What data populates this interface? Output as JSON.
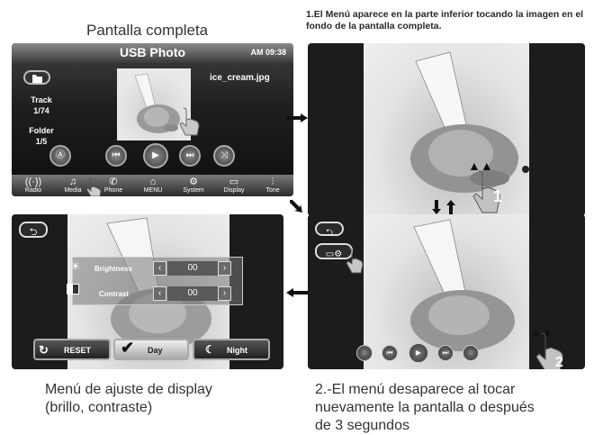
{
  "captions": {
    "top_left": "Pantalla completa",
    "top_right": "1.El Menú aparece en la parte inferior tocando la imagen en el fondo de la pantalla completa.",
    "bottom_left_1": "Menú de ajuste de display",
    "bottom_left_2": "(brillo, contraste)",
    "bottom_right_1": "2.-El menú desaparece al tocar",
    "bottom_right_2": "nuevamente la pantalla o después",
    "bottom_right_3": "de 3 segundos"
  },
  "main_screen": {
    "title": "USB Photo",
    "clock": "AM 09:38",
    "filename": "ice_cream.jpg",
    "track_label": "Track",
    "track_value": "1/74",
    "folder_label": "Folder",
    "folder_value": "1/5",
    "bottom_nav": [
      "Radio",
      "Media",
      "Phone",
      "MENU",
      "System",
      "Display",
      "Tone"
    ]
  },
  "display_menu": {
    "brightness_label": "Brightness",
    "brightness_value": "00",
    "contrast_label": "Contrast",
    "contrast_value": "00",
    "reset_label": "RESET",
    "day_label": "Day",
    "night_label": "Night"
  },
  "step_numbers": {
    "one": "1",
    "two": "2"
  },
  "icons": [
    "folder-icon",
    "repeat-icon",
    "prev-icon",
    "play-icon",
    "next-icon",
    "shuffle-icon",
    "back-icon",
    "display-settings-icon",
    "sun-icon",
    "contrast-icon",
    "refresh-icon",
    "checkmark-icon",
    "moon-icon",
    "hand-pointer-icon",
    "arrow-right-icon",
    "arrow-left-icon",
    "arrow-down-icon",
    "arrow-up-icon"
  ]
}
